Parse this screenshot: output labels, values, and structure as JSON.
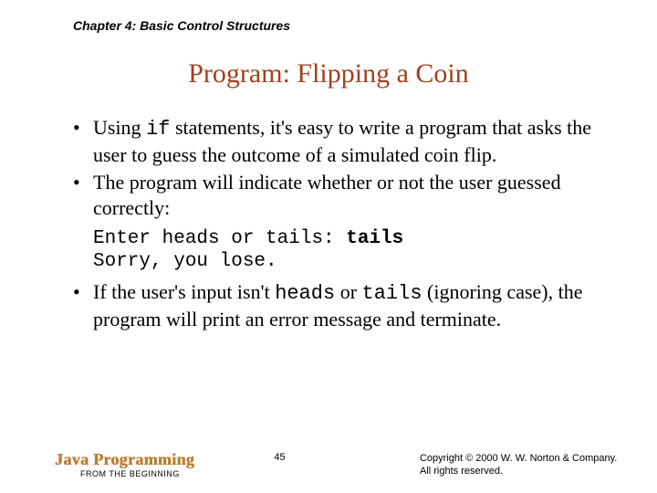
{
  "chapter": "Chapter 4: Basic Control Structures",
  "title": "Program: Flipping a Coin",
  "bullets": {
    "b1_pre": "Using ",
    "b1_code": "if",
    "b1_post": " statements, it's easy to write a program that asks the user to guess the outcome of a simulated coin flip.",
    "b2": "The program will indicate whether or not the user guessed correctly:",
    "b3_pre": "If the user's input isn't ",
    "b3_c1": "heads",
    "b3_mid": " or ",
    "b3_c2": "tails",
    "b3_post": " (ignoring case), the program will print an error message and terminate."
  },
  "code": {
    "line1_prompt": "Enter heads or tails: ",
    "line1_input": "tails",
    "line2": "Sorry, you lose."
  },
  "footer": {
    "book_title": "Java Programming",
    "book_sub": "FROM THE BEGINNING",
    "page": "45",
    "copyright1": "Copyright © 2000 W. W. Norton & Company.",
    "copyright2": "All rights reserved."
  }
}
